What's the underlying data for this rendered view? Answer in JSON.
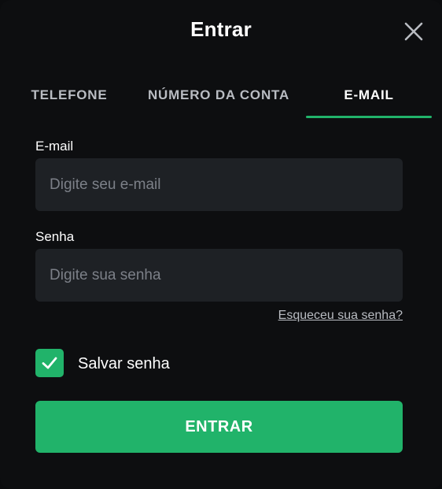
{
  "dialog": {
    "title": "Entrar",
    "close_icon": "close-icon"
  },
  "tabs": [
    {
      "label": "TELEFONE",
      "active": false
    },
    {
      "label": "NÚMERO DA CONTA",
      "active": false
    },
    {
      "label": "E-MAIL",
      "active": true
    }
  ],
  "form": {
    "email_label": "E-mail",
    "email_placeholder": "Digite seu e-mail",
    "email_value": "",
    "password_label": "Senha",
    "password_placeholder": "Digite sua senha",
    "password_value": "",
    "forgot_link": "Esqueceu sua senha?",
    "remember_label": "Salvar senha",
    "remember_checked": true,
    "submit_label": "ENTRAR"
  },
  "colors": {
    "accent": "#21b36a",
    "background": "#0d0e10",
    "input_bg": "#1e2125",
    "placeholder": "#7c8088"
  }
}
